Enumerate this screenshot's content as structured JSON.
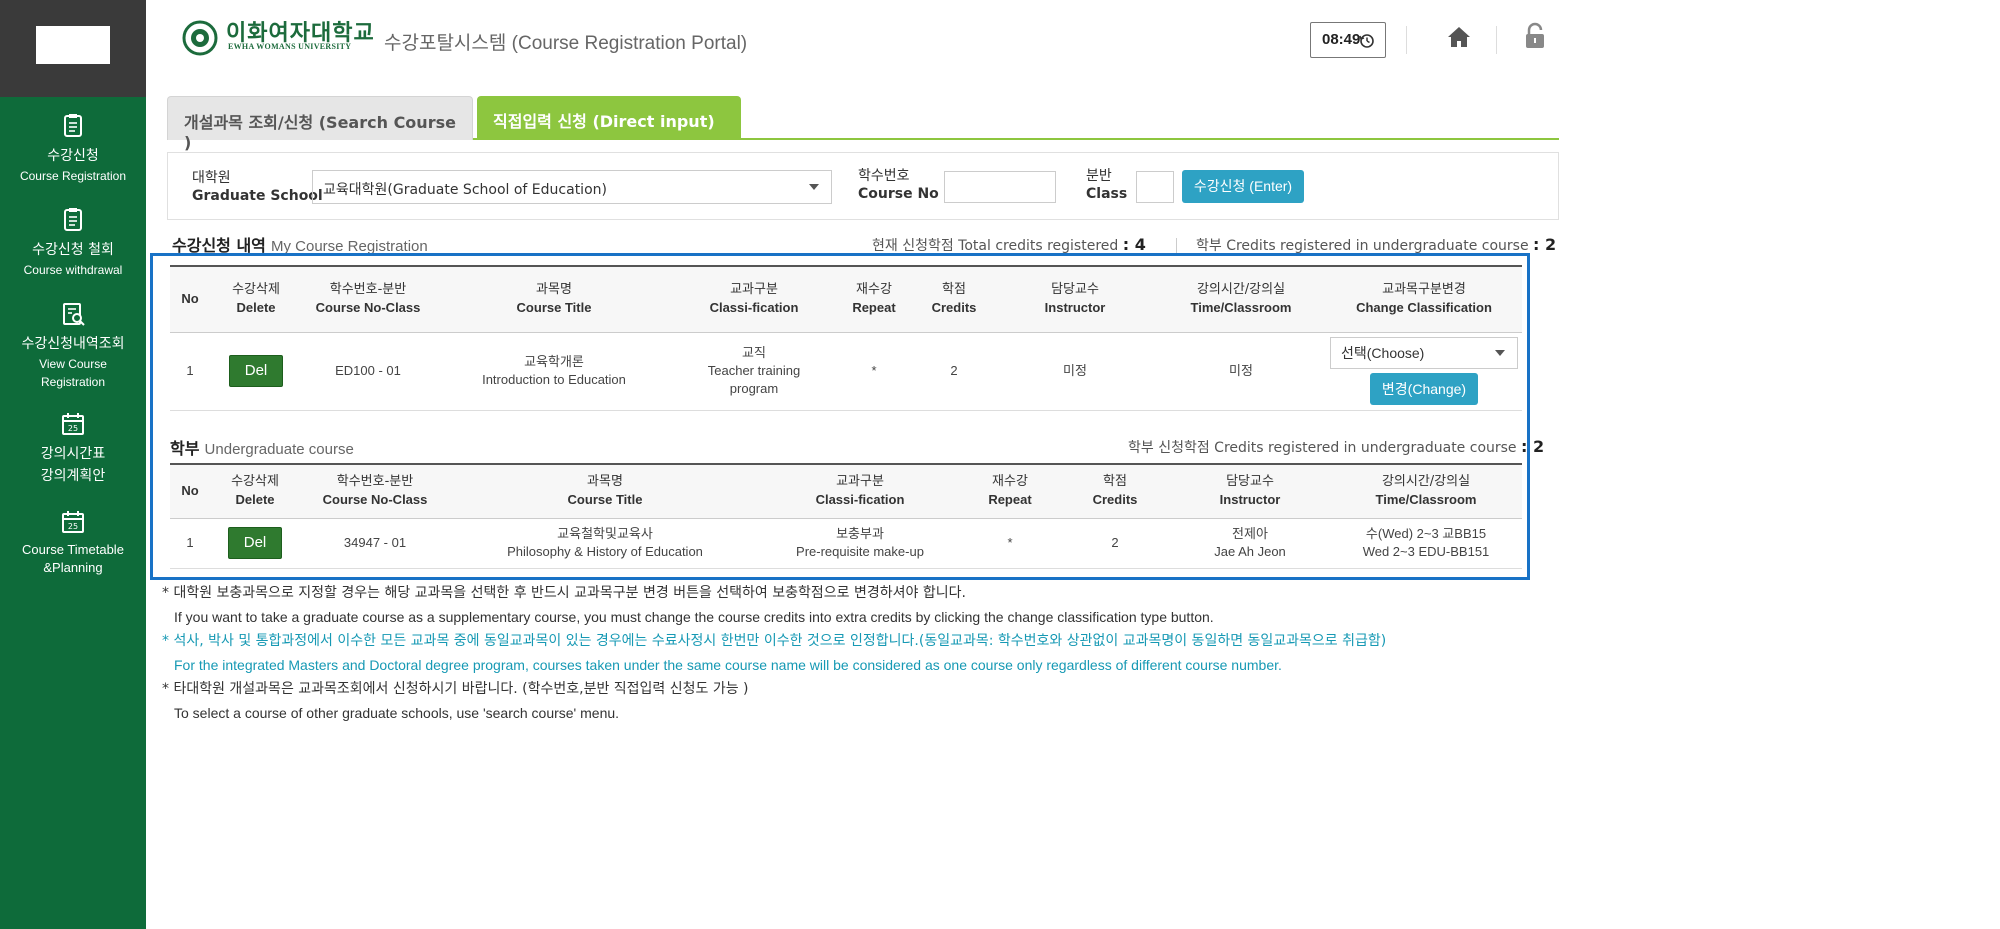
{
  "header": {
    "uni_name_kr": "이화여자대학교",
    "uni_name_en": "EWHA WOMANS UNIVERSITY",
    "portal_title": "수강포탈시스템 (Course Registration Portal)",
    "clock": "08:49"
  },
  "sidebar": {
    "items": [
      {
        "kr": "수강신청",
        "en": "Course Registration",
        "icon": "clipboard-icon"
      },
      {
        "kr": "수강신청 철회",
        "en": "Course withdrawal",
        "icon": "clipboard-icon"
      },
      {
        "kr": "수강신청내역조회",
        "en": "View Course",
        "en2": "Registration",
        "icon": "search-document-icon"
      },
      {
        "kr": "강의시간표",
        "kr2": "강의계획안",
        "icon": "calendar-icon"
      },
      {
        "en": "Course Timetable",
        "en2": "&Planning",
        "icon": "calendar-icon"
      }
    ]
  },
  "tabs": {
    "search": "개설과목 조회/신청 (Search Course )",
    "direct": "직접입력 신청 (Direct input)"
  },
  "form": {
    "school_label_kr": "대학원",
    "school_label_en": "Graduate School",
    "school_value": "교육대학원(Graduate School of Education)",
    "course_no_label_kr": "학수번호",
    "course_no_label_en": "Course No",
    "class_label_kr": "분반",
    "class_label_en": "Class",
    "enter_button": "수강신청 (Enter)"
  },
  "my_registration": {
    "title_kr": "수강신청 내역",
    "title_en": "My Course Registration",
    "total_label": "현재 신청학점 Total credits registered",
    "total_value": ": 4",
    "undergrad_label": "학부 Credits registered in undergraduate course",
    "undergrad_value": ": 2",
    "headers": {
      "no": "No",
      "delete_kr": "수강삭제",
      "delete_en": "Delete",
      "course_no_kr": "학수번호-분반",
      "course_no_en": "Course No-Class",
      "title_kr": "과목명",
      "title_en": "Course Title",
      "classi_kr": "교과구분",
      "classi_en": "Classi-fication",
      "repeat_kr": "재수강",
      "repeat_en": "Repeat",
      "credits_kr": "학점",
      "credits_en": "Credits",
      "instructor_kr": "담당교수",
      "instructor_en": "Instructor",
      "time_kr": "강의시간/강의실",
      "time_en": "Time/Classroom",
      "change_kr": "교과목구분변경",
      "change_en": "Change Classification"
    },
    "rows": [
      {
        "no": "1",
        "delete": "Del",
        "course_no": "ED100 - 01",
        "title_kr": "교육학개론",
        "title_en": "Introduction to Education",
        "classi_kr": "교직",
        "classi_en": "Teacher training program",
        "repeat": "*",
        "credits": "2",
        "instructor": "미정",
        "time": "미정",
        "choose": "선택(Choose)",
        "change": "변경(Change)"
      }
    ]
  },
  "undergrad": {
    "title_kr": "학부",
    "title_en": "Undergraduate course",
    "credits_label": "학부 신청학점 Credits registered in undergraduate course",
    "credits_value": ": 2",
    "rows": [
      {
        "no": "1",
        "delete": "Del",
        "course_no": "34947 - 01",
        "title_kr": "교육철학및교육사",
        "title_en": "Philosophy & History of Education",
        "classi_kr": "보충부과",
        "classi_en": "Pre-requisite make-up",
        "repeat": "*",
        "credits": "2",
        "instructor_kr": "전제아",
        "instructor_en": "Jae Ah Jeon",
        "time_kr": "수(Wed) 2~3 교BB15",
        "time_en": "Wed 2~3 EDU-BB151"
      }
    ]
  },
  "notes": [
    {
      "kr": "* 대학원 보충과목으로 지정할 경우는 해당 교과목을 선택한 후 반드시 교과목구분 변경 버튼을 선택하여 보충학점으로 변경하셔야 합니다.",
      "en": "If you want to take a graduate course as a supplementary course, you must change the course credits into extra credits by clicking the change classification type button.",
      "color": "#333333"
    },
    {
      "kr": "* 석사, 박사 및 통합과정에서 이수한 모든 교과목 중에 동일교과목이 있는 경우에는 수료사정시 한번만 이수한 것으로 인정합니다.(동일교과목: 학수번호와 상관없이 교과목명이 동일하면 동일교과목으로 취급함)",
      "en": "For the integrated Masters and Doctoral degree program, courses taken under the same course name will be considered as one course only regardless of different course number.",
      "color": "#1699b4"
    },
    {
      "kr": "* 타대학원 개설과목은 교과목조회에서 신청하시기 바랍니다. (학수번호,분반 직접입력 신청도 가능 )",
      "en": "To select a course of other graduate schools, use 'search course' menu.",
      "color": "#333333"
    }
  ]
}
